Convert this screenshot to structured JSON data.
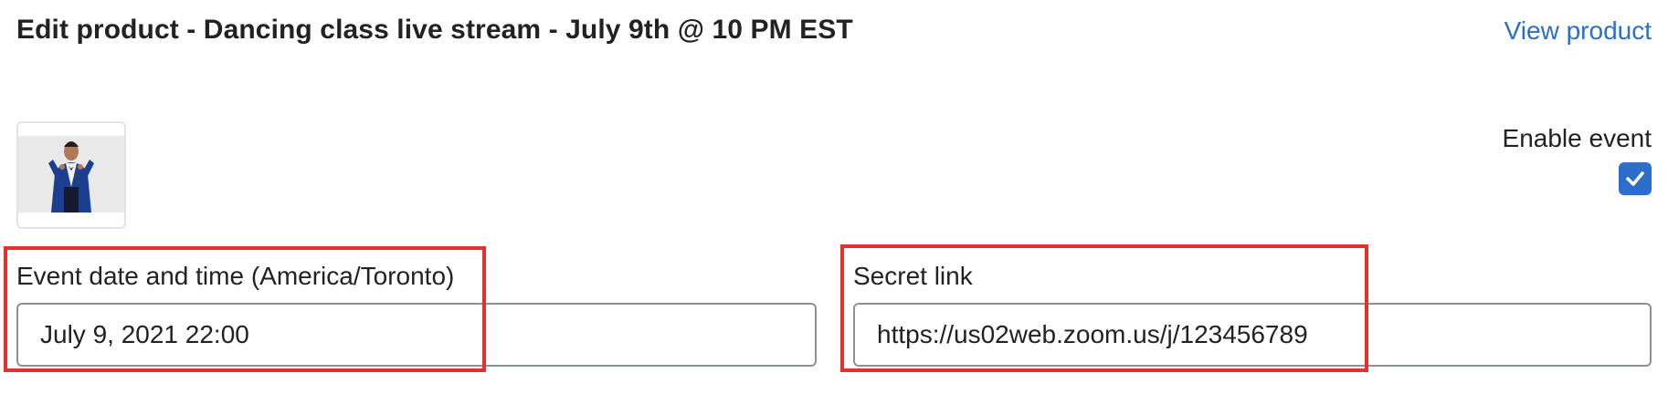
{
  "header": {
    "title": "Edit product - Dancing class live stream - July 9th @ 10 PM EST",
    "view_link": "View product"
  },
  "product": {
    "thumbnail_alt": "product-image"
  },
  "enable_event": {
    "label": "Enable event",
    "checked": true
  },
  "fields": {
    "event_date": {
      "label": "Event date and time (America/Toronto)",
      "value": "July 9, 2021 22:00"
    },
    "secret_link": {
      "label": "Secret link",
      "value": "https://us02web.zoom.us/j/123456789"
    }
  },
  "colors": {
    "accent": "#2c6ecb",
    "highlight": "#e8302a",
    "input_border": "#8c9196"
  }
}
